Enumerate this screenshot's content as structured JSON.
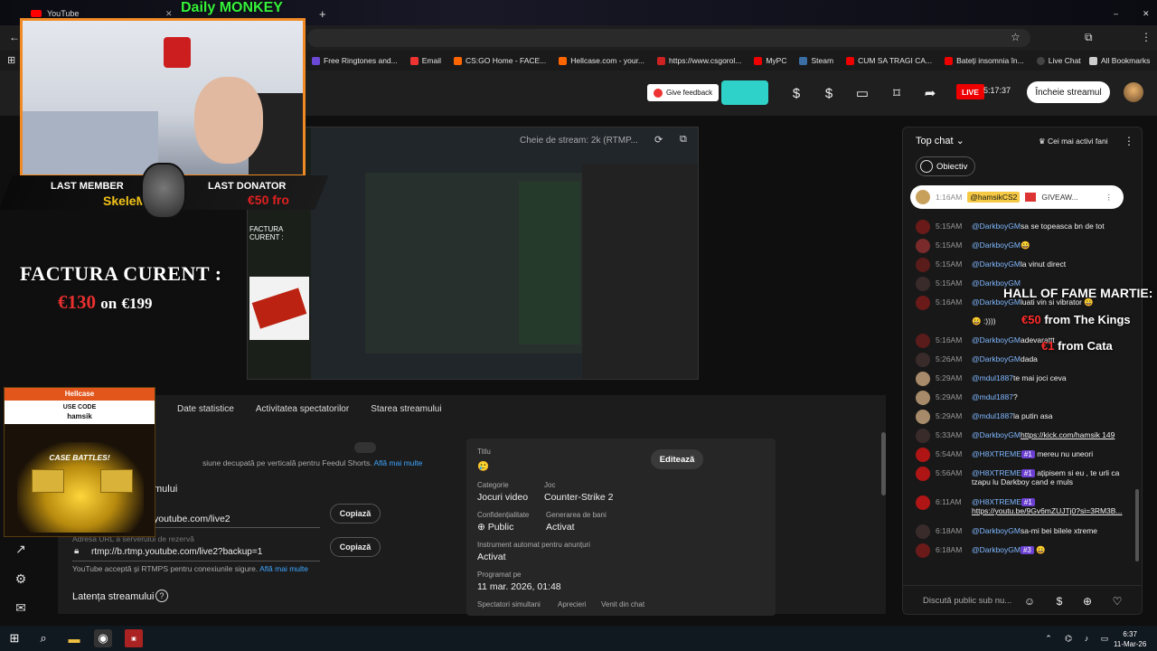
{
  "browser": {
    "tab1": "YouTube",
    "bookmarks": [
      "Free Ringtones and...",
      "Email",
      "CS:GO Home - FACE...",
      "Hellcase.com - your...",
      "https://www.csgorol...",
      "MyPC",
      "Steam",
      "CUM SA TRAGI CA...",
      "Bateți insomnia în...",
      "Live Chat"
    ],
    "all_bookmarks": "All Bookmarks"
  },
  "header": {
    "feedback": "Give feedback",
    "live": "LIVE",
    "live_time": "5:17:37",
    "end_stream": "Încheie streamul"
  },
  "preview": {
    "stream_key": "Cheie de stream: 2k (RTMP..."
  },
  "tabs": [
    "Date statistice",
    "Activitatea spectatorilor",
    "Starea streamului"
  ],
  "details": {
    "shorts_text": "siune decupată pe verticală pentru Feedul Shorts.",
    "learn_more": "Află mai multe",
    "url_section": "mului",
    "url1": "youtube.com/live2",
    "url2_label": "Adresa URL a serverului de rezervă",
    "url2": "rtmp://b.rtmp.youtube.com/live2?backup=1",
    "copy": "Copiază",
    "rtmps_note": "YouTube acceptă și RTMPS pentru conexiunile sigure.",
    "latency": "Latența streamului"
  },
  "card": {
    "title_label": "Titlu",
    "title_value": "🥲",
    "edit": "Editează",
    "category_label": "Categorie",
    "category_value": "Jocuri video",
    "game_label": "Joc",
    "game_value": "Counter-Strike 2",
    "privacy_label": "Confidențialitate",
    "privacy_value": "Public",
    "monetize_label": "Generarea de bani",
    "monetize_value": "Activat",
    "ads_label": "Instrument automat pentru anunțuri",
    "ads_value": "Activat",
    "scheduled_label": "Programat pe",
    "scheduled_value": "11 mar. 2026, 01:48",
    "viewers_label": "Spectatori simultani",
    "likes_label": "Aprecieri",
    "chat_label": "Venit din chat"
  },
  "chat": {
    "header": "Top chat",
    "top_fans": "Cei mai activi fani",
    "objective": "Obiectiv",
    "pinned_time": "1:16AM",
    "pinned_author": "@hamsikCS2",
    "pinned_text": "GIVEAW...",
    "input_placeholder": "Discută public sub nu...",
    "messages": [
      {
        "time": "5:15AM",
        "author": "@DarkboyGM",
        "text": "sa se topeasca bn de tot"
      },
      {
        "time": "5:15AM",
        "author": "@DarkboyGM",
        "text": "😀"
      },
      {
        "time": "5:15AM",
        "author": "@DarkboyGM",
        "text": "la vinut direct"
      },
      {
        "time": "5:15AM",
        "author": "@DarkboyGM",
        "text": ""
      },
      {
        "time": "5:16AM",
        "author": "@DarkboyGM",
        "text": "luati vin si vibrator 😀"
      },
      {
        "time": "",
        "author": "",
        "text": "😀 :))))"
      },
      {
        "time": "5:16AM",
        "author": "@DarkboyGM",
        "text": "adevarattt"
      },
      {
        "time": "5:26AM",
        "author": "@DarkboyGM",
        "text": "dada"
      },
      {
        "time": "5:29AM",
        "author": "@mdul1887",
        "text": "te mai joci ceva"
      },
      {
        "time": "5:29AM",
        "author": "@mdul1887",
        "text": "?"
      },
      {
        "time": "5:29AM",
        "author": "@mdul1887",
        "text": "la putin asa"
      },
      {
        "time": "5:33AM",
        "author": "@DarkboyGM",
        "text": "https://kick.com/hamsik 149"
      },
      {
        "time": "5:54AM",
        "author": "@H8XTREME",
        "badge": "#1",
        "text": "mereu nu uneori"
      },
      {
        "time": "5:56AM",
        "author": "@H8XTREME",
        "badge": "#1",
        "text": "ațipisem si eu , te urli ca tzapu lu Darkboy cand e muls"
      },
      {
        "time": "6:11AM",
        "author": "@H8XTREME",
        "badge": "#1",
        "text": "https://youtu.be/9Gv6mZUJTj0?si=3RM3B..."
      },
      {
        "time": "6:18AM",
        "author": "@DarkboyGM",
        "text": "sa-mi bei bilele xtreme"
      },
      {
        "time": "6:18AM",
        "author": "@DarkboyGM",
        "badge": "#3",
        "text": "😀"
      }
    ]
  },
  "overlay": {
    "channel": "Daily MONKEY",
    "last_member": "LAST MEMBER",
    "member_name": "SkeleM",
    "last_donator": "LAST DONATOR",
    "donation": "€50 fro",
    "factura_title": "FACTURA CURENT :",
    "factura_current": "€130",
    "factura_on": "on",
    "factura_goal": "€199",
    "hellcase": "Hellcase",
    "use_code": "USE CODE",
    "code": "hamsik",
    "case_battles": "CASE BATTLES!",
    "hof_title": "HALL OF FAME MARTIE:",
    "hof1_amt": "€50",
    "hof1_name": "from The Kings",
    "hof2_amt": "€1",
    "hof2_name": "from Cata"
  },
  "taskbar": {
    "time": "6:37",
    "date": "11-Mar-26"
  }
}
